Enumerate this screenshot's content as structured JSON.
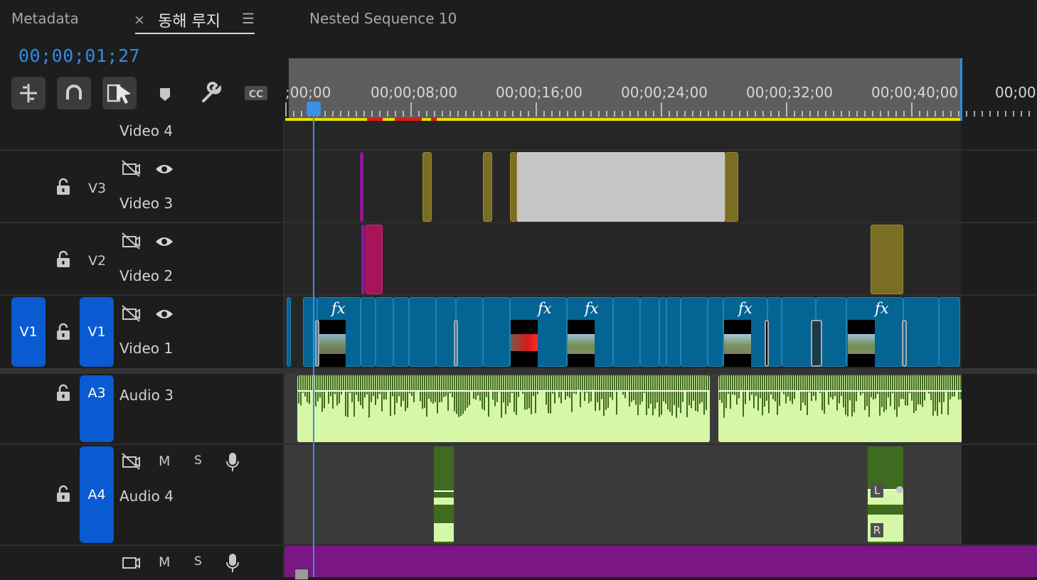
{
  "tabs": {
    "metadata": "Metadata",
    "close_symbol": "×",
    "active_label": "동해 루지",
    "menu_symbol": "☰",
    "nested": "Nested Sequence 10"
  },
  "timecode": "00;00;01;27",
  "ruler": {
    "labels": [
      ";00;00",
      "00;00;08;00",
      "00;00;16;00",
      "00;00;24;00",
      "00;00;32;00",
      "00;00;40;00",
      "00;00;"
    ]
  },
  "tracks": {
    "v4": {
      "name": "Video 4"
    },
    "v3": {
      "label": "V3",
      "name": "Video 3"
    },
    "v2": {
      "label": "V2",
      "name": "Video 2"
    },
    "v1": {
      "source": "V1",
      "label": "V1",
      "name": "Video 1"
    },
    "a3": {
      "label": "A3",
      "name": "Audio 3"
    },
    "a4": {
      "label": "A4",
      "name": "Audio 4",
      "mute": "M",
      "solo": "S"
    },
    "a5": {
      "mute": "M",
      "solo": "S"
    }
  },
  "clips": {
    "fx_label": "fx",
    "audio_l": "L",
    "audio_r": "R"
  },
  "colors": {
    "accent": "#2f8de4",
    "track_pill": "#0a5ad1",
    "video_clip": "#046594",
    "olive_clip": "#7a6d24",
    "audio_clip": "#d6f7a6",
    "audio_green": "#3e6b1f",
    "magenta": "#a8145a",
    "purple": "#7a1784"
  }
}
